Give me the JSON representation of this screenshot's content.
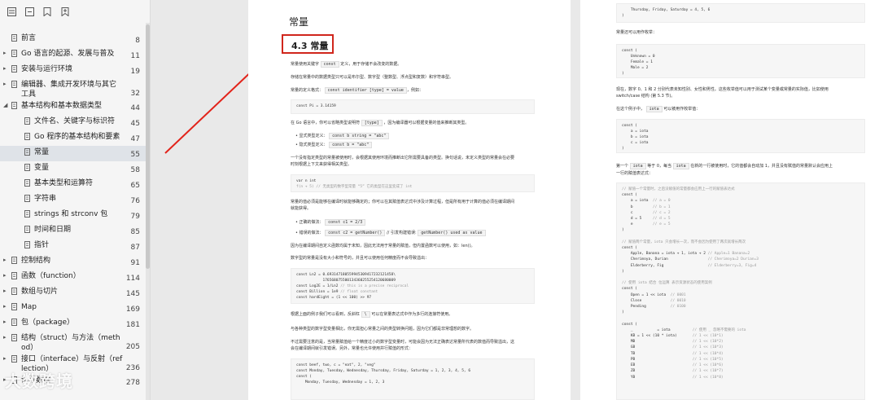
{
  "toc": [
    {
      "label": "前言",
      "page": "8",
      "level": 0,
      "caret": false
    },
    {
      "label": "Go 语言的起源、发展与普及",
      "page": "11",
      "level": 0,
      "caret": true
    },
    {
      "label": "安装与运行环境",
      "page": "19",
      "level": 0,
      "caret": true
    },
    {
      "label": "编辑器、集成开发环境与其它",
      "label2": "工具",
      "page": "32",
      "level": 0,
      "caret": true
    },
    {
      "label": "基本结构和基本数据类型",
      "page": "44",
      "level": 0,
      "caret": "open"
    },
    {
      "label": "文件名、关键字与标识符",
      "page": "45",
      "level": 1
    },
    {
      "label": "Go 程序的基本结构和要素",
      "page": "47",
      "level": 1
    },
    {
      "label": "常量",
      "page": "55",
      "level": 1,
      "active": true
    },
    {
      "label": "变量",
      "page": "58",
      "level": 1
    },
    {
      "label": "基本类型和运算符",
      "page": "65",
      "level": 1
    },
    {
      "label": "字符串",
      "page": "76",
      "level": 1
    },
    {
      "label": "strings 和 strconv 包",
      "page": "79",
      "level": 1
    },
    {
      "label": "时间和日期",
      "page": "85",
      "level": 1
    },
    {
      "label": "指针",
      "page": "87",
      "level": 1
    },
    {
      "label": "控制结构",
      "page": "91",
      "level": 0,
      "caret": true
    },
    {
      "label": "函数（function）",
      "page": "114",
      "level": 0,
      "caret": true
    },
    {
      "label": "数组与切片",
      "page": "145",
      "level": 0,
      "caret": true
    },
    {
      "label": "Map",
      "page": "169",
      "level": 0,
      "caret": true
    },
    {
      "label": "包（package）",
      "page": "181",
      "level": 0,
      "caret": true
    },
    {
      "label": "结构（struct）与方法（meth",
      "label2": "od）",
      "page": "205",
      "level": 0,
      "caret": true
    },
    {
      "label": "接口（interface）与反射（ref",
      "label2": "lection）",
      "page": "236",
      "level": 0,
      "caret": true
    },
    {
      "label": "读写数据",
      "page": "278",
      "level": 0,
      "caret": true
    }
  ],
  "watermark": "大数跨境",
  "page1": {
    "chapter": "常量",
    "section": "4.3 常量",
    "p1": "常量使用关键字",
    "p1_code": "const",
    "p1_rest": "定义，用于存储不会改变的数据。",
    "p2": "存储在常量中的数据类型只可以是布尔型、数字型（整数型、浮点型和复数）和字符串型。",
    "p3": "常量的定义格式：",
    "p3_code": "const identifier [type] = value",
    "p3_rest": "，例如：",
    "code1": "const Pi = 3.14159",
    "p4": "在 Go 语言中，你可以省略类型说明符",
    "p4_code": "[type]",
    "p4_rest": "，因为编译器可以根据变量的值来推断其类型。",
    "b1": "显式类型定义：",
    "b1_code": "const b string = \"abc\"",
    "b2": "隐式类型定义：",
    "b2_code": "const b = \"abc\"",
    "p5": "一个没有指定类型的常量被使用时，会根据其使用环境而推断出它所需要具备的类型。换句话说，未定义类型的常量会在必要",
    "p5b": "时刻根据上下文来获得相关类型。",
    "code2a": "var n int",
    "code2b": "f(n + 5) // 无类型的数字型常量 “5” 它的类型在这里变成了 int",
    "p6": "常量的值必须是能够在编译时就能够确定的；你可以在其赋值表达式中涉及计算过程，但是所有用于计算的值必须在编译期间",
    "p6b": "就能获得。",
    "b3": "正确的做法：",
    "b3_code": "const c1 = 2/3",
    "b4": "错误的做法：",
    "b4_code": "const c2 = getNumber()",
    "b4_rest": "// 引发构建错误:",
    "b4_code2": "getNumber() used as value",
    "p7": "因为在编译期间自定义函数均属于未知，因此无法用于常量的赋值，但内置函数可以使用，如：len()。",
    "p8": "数字型的常量是没有大小和符号的，并且可以使用任何精度而不会导致溢出：",
    "code3": [
      "const Ln2 = 0.693147180559945309417232121458\\",
      "            176568075500134360255254120680009",
      "const Log2E = 1/Ln2 // this is a precise reciprocal",
      "const Billion = 1e9 // float constant",
      "const hardEight = (1 << 100) >> 97"
    ],
    "p9": "根据上面的例子我们可以看到，反斜杠",
    "p9_code": "\\",
    "p9_rest": "可以在常量表达式中作为多行的连接符使用。",
    "p10": "与各种类型的数字型变量相比，你无需担心常量之间的类型转换问题，因为它们都是非常理想的数字。",
    "p11": "不过需要注意的是，当常量赋值给一个精度过小的数字型变量时，可能会因为无法正确表达常量所代表的数值而导致溢出，这",
    "p11b": "会在编译期间就引发错误。另外，常量也允许使用并行赋值的形式：",
    "code4": [
      "const beef, two, c = \"eat\", 2, \"veg\"",
      "const Monday, Tuesday, Wednesday, Thursday, Friday, Saturday = 1, 2, 3, 4, 5, 6",
      "const (",
      "    Monday, Tuesday, Wednesday = 1, 2, 3"
    ]
  },
  "page2": {
    "code0": "    Thursday, Friday, Saturday = 4, 5, 6\n)",
    "t1": "常量还可以用作枚举：",
    "code1": [
      "const (",
      "    Unknown = 0",
      "    Female = 1",
      "    Male = 2",
      ")"
    ],
    "t2": "现在，数字 0、1 和 2 分别代表未知性别、女性和男性。这些枚举值可以用于测试某个变量或常量的实际值，比如使用",
    "t2b": "switch/case 结构 (第 5.3 节)。",
    "t3": "在这个例子中，",
    "t3_code": "iota",
    "t3_rest": "可以被用作枚举值：",
    "code2": [
      "const (",
      "    a = iota",
      "    b = iota",
      "    c = iota",
      ")"
    ],
    "t4": "第一个",
    "t4_code": "iota",
    "t4_mid": "等于 0，每当",
    "t4_code2": "iota",
    "t4_rest": "在新的一行被使用时，它的值都会自动加 1，并且没有赋值的常量默认会应用上",
    "t4b": "一行的赋值表达式：",
    "code3": [
      "// 赋值一个常量时，之后没赋值的常量都会应用上一行的赋值表达式",
      "const (",
      "    a = iota  // a = 0",
      "    b         // b = 1",
      "    c         // c = 2",
      "    d = 5     // d = 5",
      "    e         // e = 5",
      ")",
      "",
      "// 赋值两个常量，iota 只会增长一次，而不会因为使用了两次就增长两次",
      "const (",
      "    Apple, Banana = iota + 1, iota + 2 // Apple=1 Banana=2",
      "    Cherimoya, Durian                  // Cherimoya=2 Durian=3",
      "    Elderberry, Fig                    // Elderberry=3, Fig=4",
      ")",
      "",
      "// 使用 iota 结合 位运算 表示资源状态的使用案例",
      "const (",
      "    Open = 1 << iota  // 0001",
      "    Close             // 0010",
      "    Pending           // 0100",
      ")",
      "",
      "const (",
      "    _           = iota          // 使用 _ 忽略不需要的 iota",
      "    KB = 1 << (10 * iota)       // 1 << (10*1)",
      "    MB                          // 1 << (10*2)",
      "    GB                          // 1 << (10*3)",
      "    TB                          // 1 << (10*4)",
      "    PB                          // 1 << (10*5)",
      "    EB                          // 1 << (10*6)",
      "    ZB                          // 1 << (10*7)",
      "    YB                          // 1 << (10*8)"
    ]
  }
}
